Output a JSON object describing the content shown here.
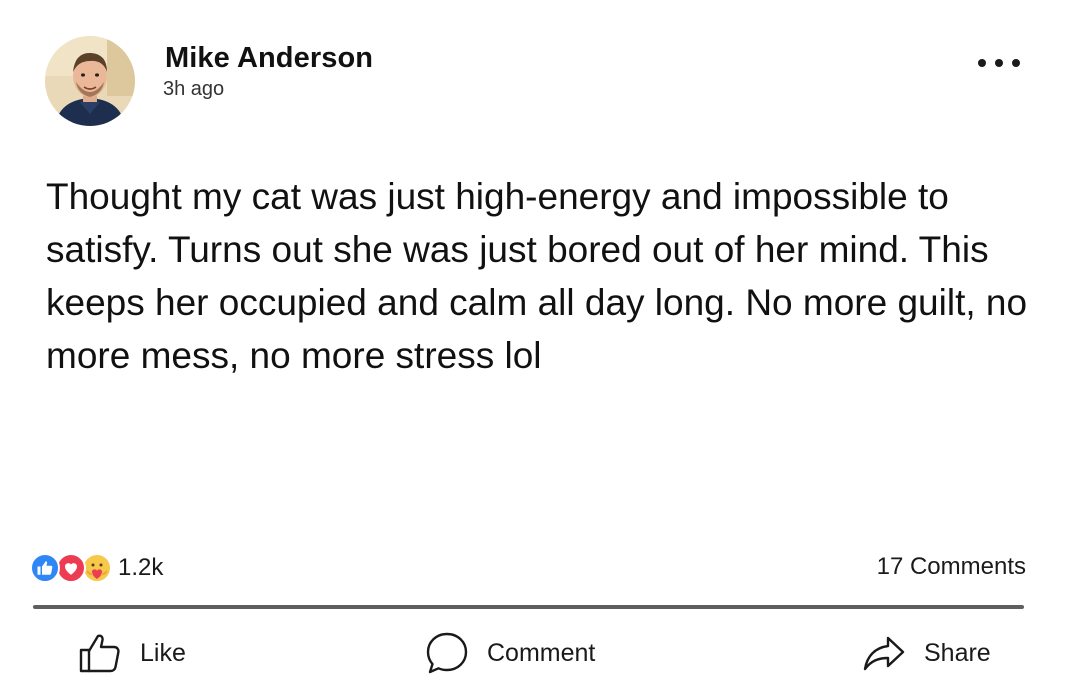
{
  "post": {
    "author": "Mike Anderson",
    "timestamp": "3h ago",
    "text": "Thought my cat was just high-energy and impossible to satisfy. Turns out she was just bored out of her mind. This keeps her occupied and calm all day long. No more guilt, no more mess, no more stress lol"
  },
  "stats": {
    "reaction_types": [
      "like-icon",
      "love-icon",
      "care-icon"
    ],
    "reaction_count": "1.2k",
    "comments": "17 Comments"
  },
  "actions": {
    "like": "Like",
    "comment": "Comment",
    "share": "Share"
  },
  "colors": {
    "like_blue": "#2f86f6",
    "love_red": "#ee3b54",
    "care_yellow": "#f6c94a",
    "divider": "#5f5f5f"
  }
}
